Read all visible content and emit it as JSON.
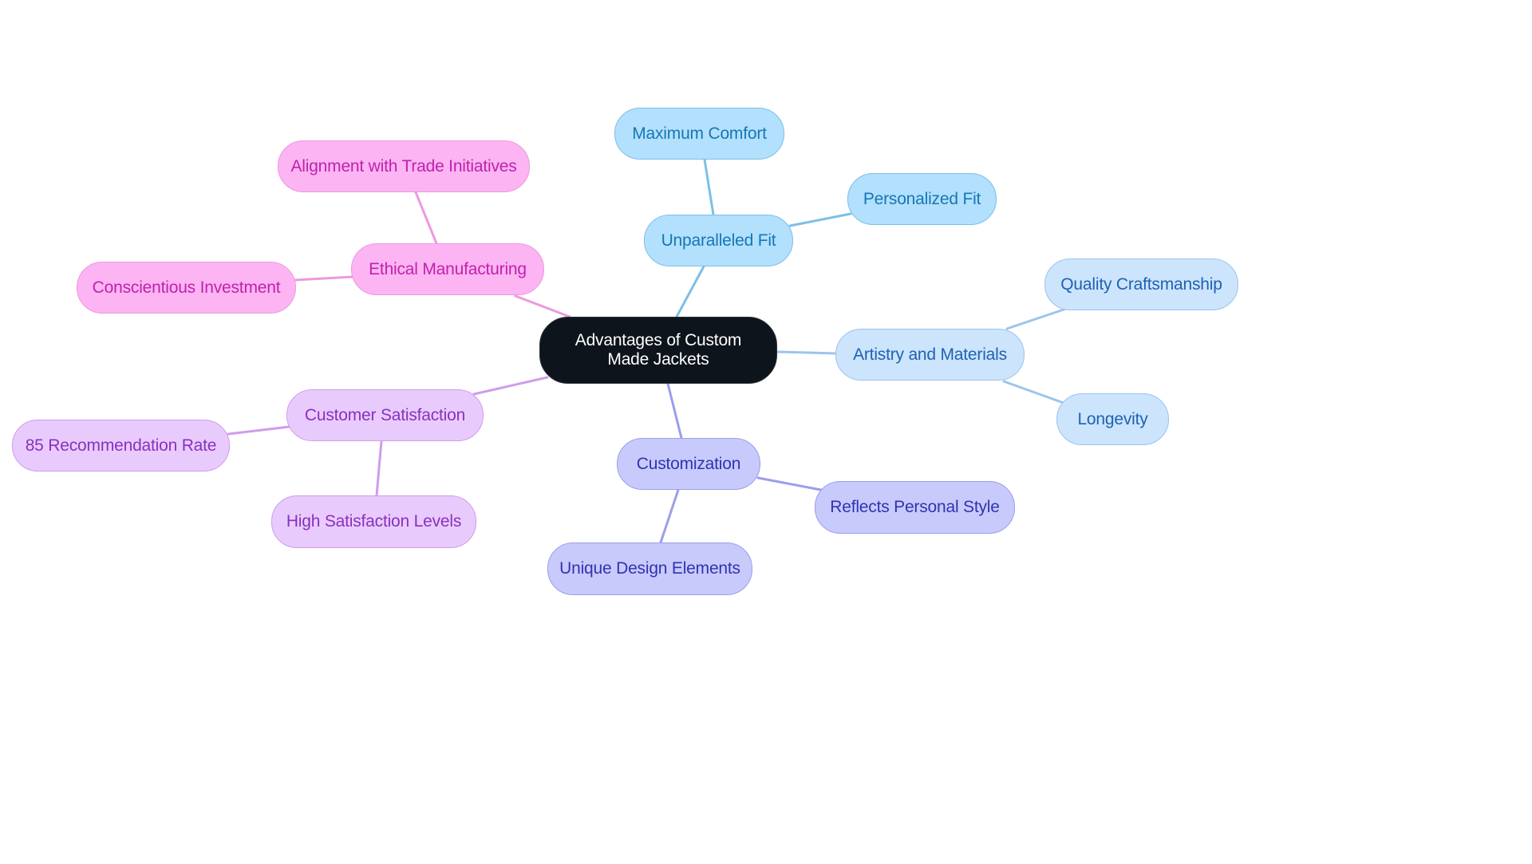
{
  "diagram": {
    "type": "mindmap",
    "root": {
      "id": "root",
      "label": "Advantages of Custom Made Jackets",
      "colors": {
        "fill": "#0d141b",
        "stroke": "#2a3038",
        "text": "#ffffff"
      }
    },
    "branches": [
      {
        "id": "fit",
        "label": "Unparalleled Fit",
        "colors": {
          "fill": "#b3e0fc",
          "stroke": "#7cbfe8",
          "text": "#1477b8",
          "edge": "#7cbfe8"
        },
        "children": [
          {
            "id": "comfort",
            "label": "Maximum Comfort"
          },
          {
            "id": "personalized",
            "label": "Personalized Fit"
          }
        ]
      },
      {
        "id": "artistry",
        "label": "Artistry and Materials",
        "colors": {
          "fill": "#cce4fc",
          "stroke": "#9cc4ec",
          "text": "#1d62b3",
          "edge": "#9cc4ec"
        },
        "children": [
          {
            "id": "craft",
            "label": "Quality Craftsmanship"
          },
          {
            "id": "longevity",
            "label": "Longevity"
          }
        ]
      },
      {
        "id": "custom",
        "label": "Customization",
        "colors": {
          "fill": "#c8cafc",
          "stroke": "#9b9eea",
          "text": "#3033b0",
          "edge": "#9b9eea"
        },
        "children": [
          {
            "id": "style",
            "label": "Reflects Personal Style"
          },
          {
            "id": "unique",
            "label": "Unique Design Elements"
          }
        ]
      },
      {
        "id": "satisfaction",
        "label": "Customer Satisfaction",
        "colors": {
          "fill": "#e8cbfc",
          "stroke": "#cf9ceb",
          "text": "#8a30bf",
          "edge": "#cf9ceb"
        },
        "children": [
          {
            "id": "rec",
            "label": "85 Recommendation Rate"
          },
          {
            "id": "high",
            "label": "High Satisfaction Levels"
          }
        ]
      },
      {
        "id": "ethical",
        "label": "Ethical Manufacturing",
        "colors": {
          "fill": "#fcb4f2",
          "stroke": "#eb9ade",
          "text": "#c021b0",
          "edge": "#eb9ade"
        },
        "children": [
          {
            "id": "trade",
            "label": "Alignment with Trade Initiatives"
          },
          {
            "id": "invest",
            "label": "Conscientious Investment"
          }
        ]
      }
    ]
  }
}
